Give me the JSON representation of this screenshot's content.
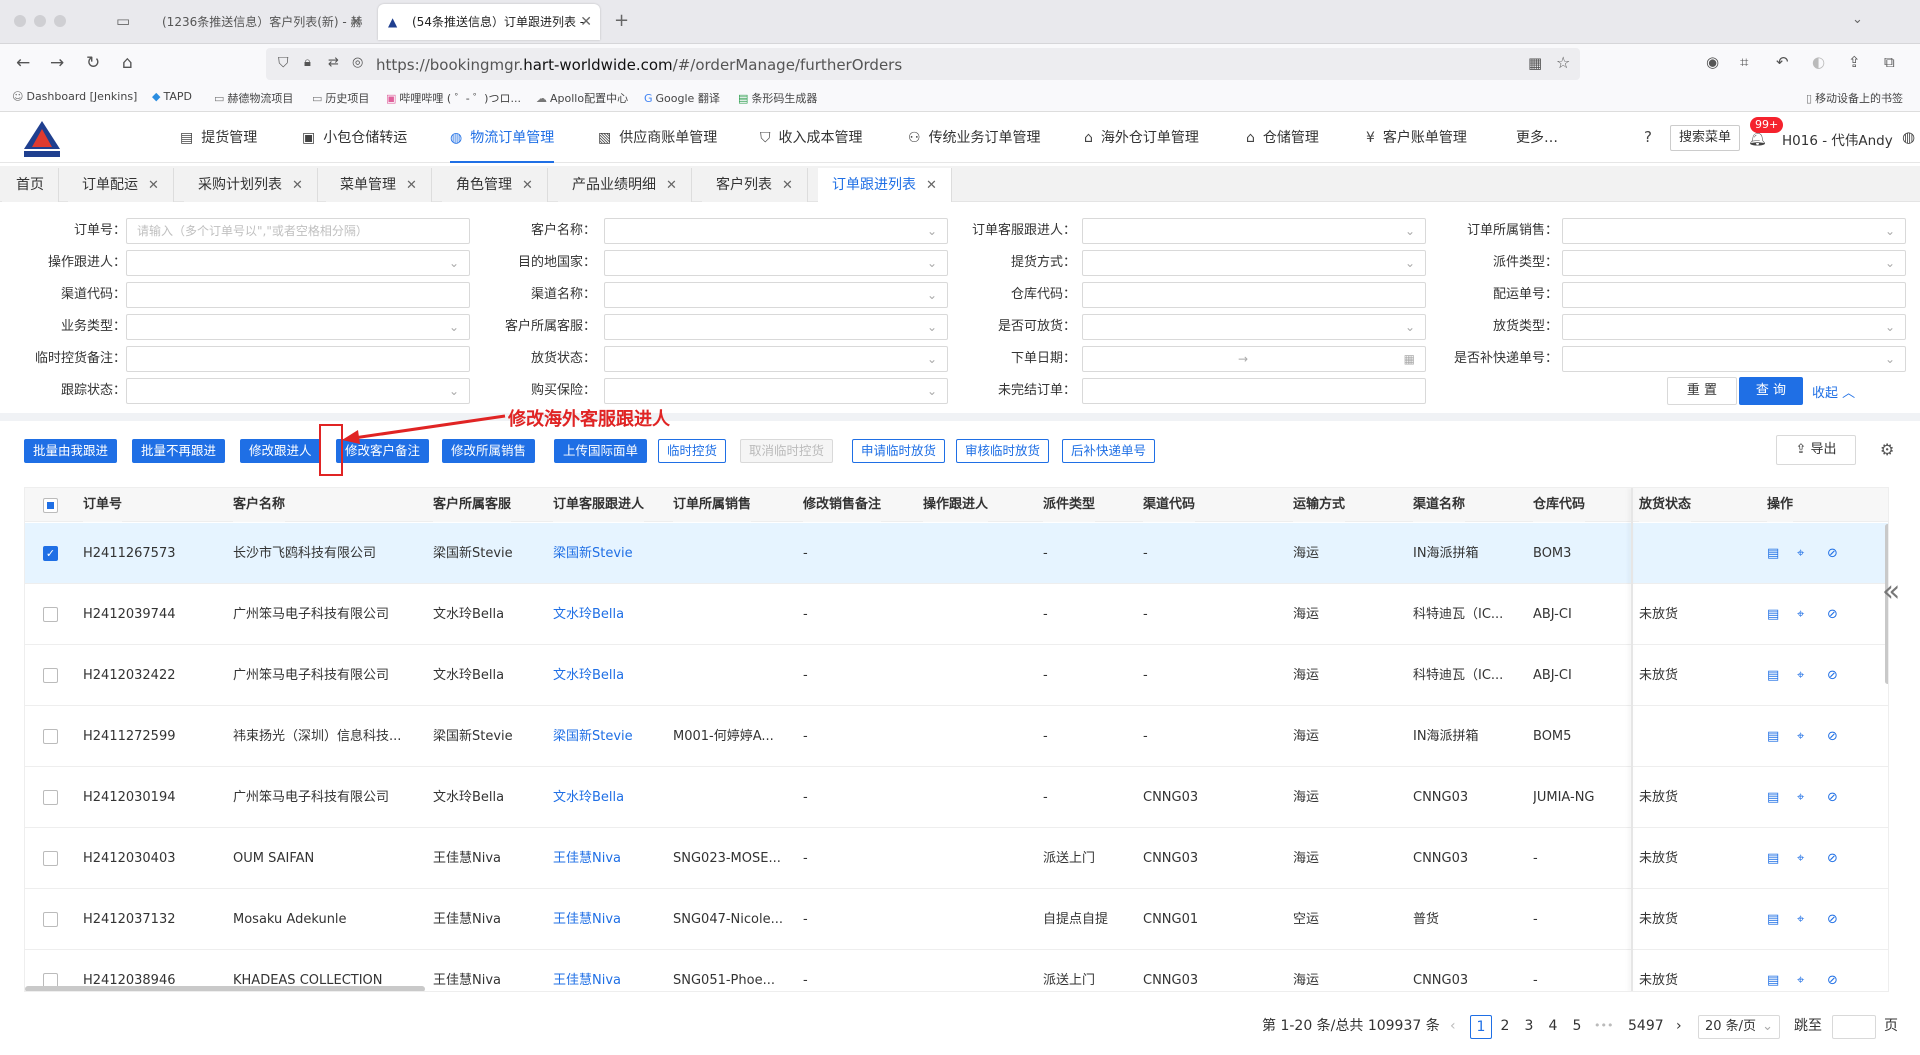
{
  "browser": {
    "tabs": [
      {
        "title": "(1236条推送信息）客户列表(新) - 赫",
        "active": false
      },
      {
        "title": "(54条推送信息）订单跟进列表 -",
        "active": true
      }
    ],
    "url_prefix": "https://bookingmgr.",
    "url_domain": "hart-worldwide.com",
    "url_suffix": "/#/orderManage/furtherOrders",
    "bookmarks": [
      "Dashboard [Jenkins]",
      "TAPD",
      "赫德物流项目",
      "历史项目",
      "哔哩哔哩 ( ゜- ゜)つロ...",
      "Apollo配置中心",
      "Google 翻译",
      "条形码生成器"
    ],
    "mobile_bookmarks": "移动设备上的书签"
  },
  "app": {
    "logo_text": "HART赫德",
    "menu": [
      {
        "label": "提货管理",
        "icon": "truck-icon"
      },
      {
        "label": "小包仓储转运",
        "icon": "package-icon"
      },
      {
        "label": "物流订单管理",
        "icon": "globe-icon",
        "active": true
      },
      {
        "label": "供应商账单管理",
        "icon": "invoice-icon"
      },
      {
        "label": "收入成本管理",
        "icon": "shield-icon"
      },
      {
        "label": "传统业务订单管理",
        "icon": "network-icon"
      },
      {
        "label": "海外仓订单管理",
        "icon": "house-icon"
      },
      {
        "label": "仓储管理",
        "icon": "home-icon"
      },
      {
        "label": "客户账单管理",
        "icon": "yen-icon"
      },
      {
        "label": "更多…",
        "icon": ""
      }
    ],
    "search_menu": "搜索菜单",
    "notif_badge": "99+",
    "user": "H016 - 代伟Andy"
  },
  "page_tabs": [
    "首页",
    "订单配运",
    "采购计划列表",
    "菜单管理",
    "角色管理",
    "产品业绩明细",
    "客户列表",
    "订单跟进列表"
  ],
  "filters": {
    "col1": [
      {
        "label": "订单号：",
        "placeholder": "请输入（多个订单号以\",\"或者空格相分隔）",
        "type": "text"
      },
      {
        "label": "操作跟进人：",
        "placeholder": "",
        "type": "select"
      },
      {
        "label": "渠道代码：",
        "placeholder": "",
        "type": "text"
      },
      {
        "label": "业务类型：",
        "placeholder": "",
        "type": "select"
      },
      {
        "label": "临时控货备注：",
        "placeholder": "",
        "type": "text"
      },
      {
        "label": "跟踪状态：",
        "placeholder": "",
        "type": "select"
      }
    ],
    "col2": [
      {
        "label": "客户名称：",
        "type": "select"
      },
      {
        "label": "目的地国家：",
        "type": "select"
      },
      {
        "label": "渠道名称：",
        "type": "select"
      },
      {
        "label": "客户所属客服：",
        "type": "select"
      },
      {
        "label": "放货状态：",
        "type": "select"
      },
      {
        "label": "购买保险：",
        "type": "select"
      }
    ],
    "col3": [
      {
        "label": "订单客服跟进人：",
        "type": "select"
      },
      {
        "label": "提货方式：",
        "type": "select"
      },
      {
        "label": "仓库代码：",
        "type": "text"
      },
      {
        "label": "是否可放货：",
        "type": "select"
      },
      {
        "label": "下单日期：",
        "type": "date"
      },
      {
        "label": "未完结订单：",
        "type": "text"
      }
    ],
    "col4": [
      {
        "label": "订单所属销售：",
        "type": "select"
      },
      {
        "label": "派件类型：",
        "type": "select"
      },
      {
        "label": "配运单号：",
        "type": "text"
      },
      {
        "label": "放货类型：",
        "type": "select"
      },
      {
        "label": "是否补快递单号：",
        "type": "select"
      }
    ],
    "reset": "重 置",
    "query": "查 询",
    "collapse": "收起"
  },
  "annotation": "修改海外客服跟进人",
  "actions": [
    {
      "label": "批量由我跟进",
      "style": "primary"
    },
    {
      "label": "批量不再跟进",
      "style": "primary"
    },
    {
      "label": "修改跟进人",
      "style": "primary"
    },
    {
      "label": "修改客户备注",
      "style": "primary"
    },
    {
      "label": "修改所属销售",
      "style": "primary"
    },
    {
      "label": "上传国际面单",
      "style": "primary"
    },
    {
      "label": "临时控货",
      "style": "outline"
    },
    {
      "label": "取消临时控货",
      "style": "disabled"
    },
    {
      "label": "申请临时放货",
      "style": "outline"
    },
    {
      "label": "审核临时放货",
      "style": "outline"
    },
    {
      "label": "后补快递单号",
      "style": "outline"
    }
  ],
  "export": "导出",
  "table": {
    "columns": [
      "订单号",
      "客户名称",
      "客户所属客服",
      "订单客服跟进人",
      "订单所属销售",
      "修改销售备注",
      "操作跟进人",
      "派件类型",
      "渠道代码",
      "运输方式",
      "渠道名称",
      "仓库代码",
      "放货状态",
      "操作"
    ],
    "rows": [
      {
        "checked": true,
        "order": "H2411267573",
        "customer": "长沙市飞鸥科技有限公司",
        "cs": "梁国新Stevie",
        "follower": "梁国新Stevie",
        "sales": "",
        "remark": "-",
        "op": "",
        "dispatch": "-",
        "channel_code": "-",
        "transport": "海运",
        "channel_name": "IN海派拼箱",
        "warehouse": "BOM3",
        "release": ""
      },
      {
        "checked": false,
        "order": "H2412039744",
        "customer": "广州笨马电子科技有限公司",
        "cs": "文水玲Bella",
        "follower": "文水玲Bella",
        "sales": "",
        "remark": "-",
        "op": "",
        "dispatch": "-",
        "channel_code": "-",
        "transport": "海运",
        "channel_name": "科特迪瓦（IC...",
        "warehouse": "ABJ-CI",
        "release": "未放货"
      },
      {
        "checked": false,
        "order": "H2412032422",
        "customer": "广州笨马电子科技有限公司",
        "cs": "文水玲Bella",
        "follower": "文水玲Bella",
        "sales": "",
        "remark": "-",
        "op": "",
        "dispatch": "-",
        "channel_code": "-",
        "transport": "海运",
        "channel_name": "科特迪瓦（IC...",
        "warehouse": "ABJ-CI",
        "release": "未放货"
      },
      {
        "checked": false,
        "order": "H2411272599",
        "customer": "祎束扬光（深圳）信息科技...",
        "cs": "梁国新Stevie",
        "follower": "梁国新Stevie",
        "sales": "M001-何婷婷A...",
        "remark": "-",
        "op": "",
        "dispatch": "-",
        "channel_code": "-",
        "transport": "海运",
        "channel_name": "IN海派拼箱",
        "warehouse": "BOM5",
        "release": ""
      },
      {
        "checked": false,
        "order": "H2412030194",
        "customer": "广州笨马电子科技有限公司",
        "cs": "文水玲Bella",
        "follower": "文水玲Bella",
        "sales": "",
        "remark": "-",
        "op": "",
        "dispatch": "-",
        "channel_code": "CNNG03",
        "transport": "海运",
        "channel_name": "CNNG03",
        "warehouse": "JUMIA-NG",
        "release": "未放货"
      },
      {
        "checked": false,
        "order": "H2412030403",
        "customer": "OUM SAIFAN",
        "cs": "王佳慧Niva",
        "follower": "王佳慧Niva",
        "sales": "SNG023-MOSE...",
        "remark": "-",
        "op": "",
        "dispatch": "派送上门",
        "channel_code": "CNNG03",
        "transport": "海运",
        "channel_name": "CNNG03",
        "warehouse": "-",
        "release": "未放货"
      },
      {
        "checked": false,
        "order": "H2412037132",
        "customer": "Mosaku Adekunle",
        "cs": "王佳慧Niva",
        "follower": "王佳慧Niva",
        "sales": "SNG047-Nicole...",
        "remark": "-",
        "op": "",
        "dispatch": "自提点自提",
        "channel_code": "CNNG01",
        "transport": "空运",
        "channel_name": "普货",
        "warehouse": "-",
        "release": "未放货"
      },
      {
        "checked": false,
        "order": "H2412038946",
        "customer": "KHADEAS COLLECTION",
        "cs": "王佳慧Niva",
        "follower": "王佳慧Niva",
        "sales": "SNG051-Phoe...",
        "remark": "-",
        "op": "",
        "dispatch": "派送上门",
        "channel_code": "CNNG03",
        "transport": "海运",
        "channel_name": "CNNG03",
        "warehouse": "-",
        "release": "未放货"
      }
    ]
  },
  "pagination": {
    "summary": "第 1-20 条/总共 109937 条",
    "pages": [
      "1",
      "2",
      "3",
      "4",
      "5"
    ],
    "ellipsis": "•••",
    "last": "5497",
    "page_size": "20 条/页",
    "jump_label": "跳至",
    "page_suffix": "页"
  }
}
